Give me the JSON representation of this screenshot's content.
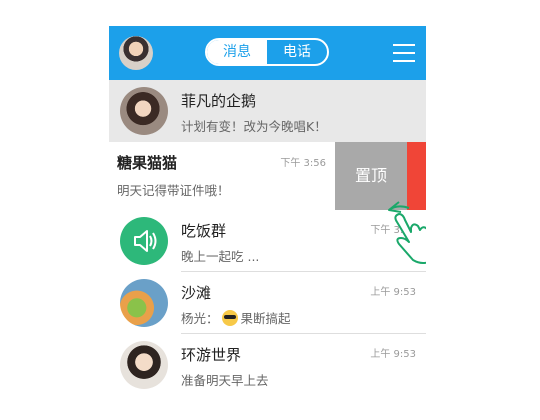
{
  "header": {
    "tabs": [
      {
        "label": "消息",
        "active": true
      },
      {
        "label": "电话",
        "active": false
      }
    ]
  },
  "conversations": [
    {
      "name": "菲凡的企鹅",
      "message": "计划有变！改为今晚唱K！",
      "time": ""
    },
    {
      "name": "糖果猫猫",
      "message": "明天记得带证件哦！",
      "time": "下午 3:56"
    },
    {
      "name": "吃饭群",
      "message": "晚上一起吃 ...",
      "time": "下午 3:56"
    },
    {
      "name": "沙滩",
      "message_prefix": "杨光：",
      "message": "果断搞起",
      "time": "上午 9:53"
    },
    {
      "name": "环游世界",
      "message": "准备明天早上去",
      "time": "上午 9:53"
    }
  ],
  "swipe_actions": {
    "pin_label": "置顶"
  },
  "colors": {
    "header": "#1ca0ea",
    "pin": "#a9a9a9",
    "delete": "#f04537",
    "group_avatar": "#2db87a"
  }
}
